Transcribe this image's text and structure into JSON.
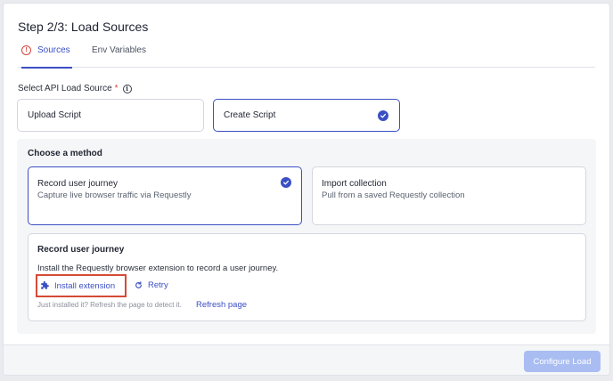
{
  "header": {
    "title": "Step 2/3: Load Sources"
  },
  "tabs": [
    {
      "label": "Sources",
      "active": true,
      "icon": "error-circle-icon"
    },
    {
      "label": "Env Variables",
      "active": false
    }
  ],
  "load_source": {
    "label": "Select API Load Source",
    "required_mark": "*",
    "info_icon": "i",
    "options": [
      {
        "label": "Upload Script",
        "selected": false
      },
      {
        "label": "Create Script",
        "selected": true
      }
    ]
  },
  "method": {
    "title": "Choose a method",
    "cards": [
      {
        "title": "Record user journey",
        "subtitle": "Capture live browser traffic via Requestly",
        "selected": true
      },
      {
        "title": "Import collection",
        "subtitle": "Pull from a saved Requestly collection",
        "selected": false
      }
    ]
  },
  "record_panel": {
    "title": "Record user journey",
    "description": "Install the Requestly browser extension to record a user journey.",
    "install_label": "Install extension",
    "retry_label": "Retry",
    "hint": "Just installed it? Refresh the page to detect it.",
    "refresh_label": "Refresh page"
  },
  "footer": {
    "configure_label": "Configure Load",
    "configure_disabled": true
  },
  "colors": {
    "accent": "#3b4fc4",
    "error": "#d6453d",
    "highlight_border": "#d64a35",
    "disabled_button": "#a9bdf2"
  }
}
